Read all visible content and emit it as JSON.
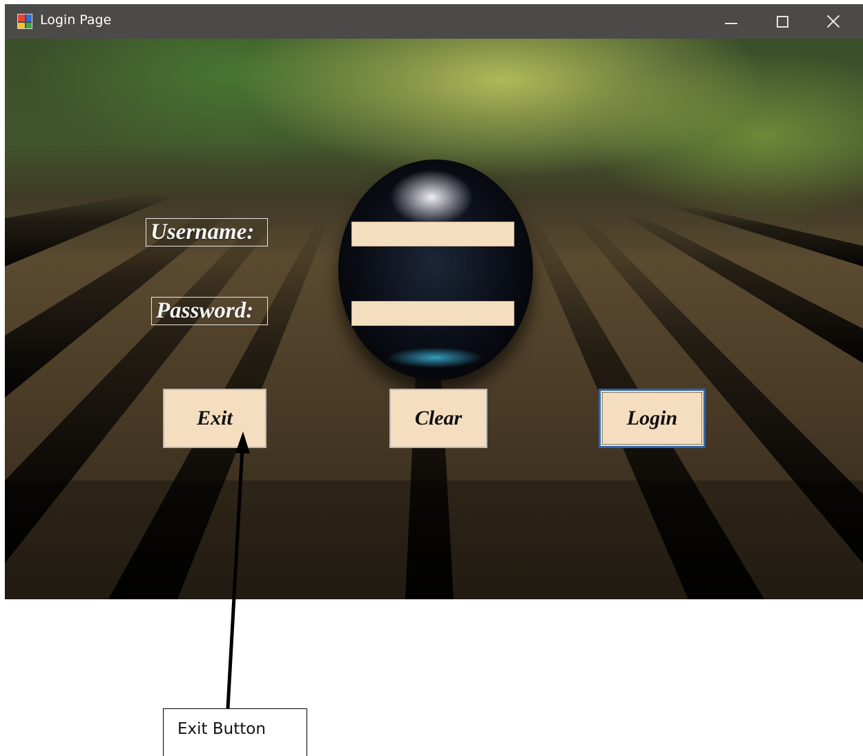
{
  "window": {
    "title": "Login Page",
    "icon": "winforms-app-icon",
    "controls": [
      "minimize-icon",
      "maximize-icon",
      "close-icon"
    ]
  },
  "form": {
    "username_label": "Username:",
    "password_label": "Password:",
    "username_value": "",
    "password_value": "",
    "buttons": {
      "exit": "Exit",
      "clear": "Clear",
      "login": "Login"
    }
  },
  "callout": {
    "label": "Exit Button"
  },
  "colors": {
    "titlebar": "#4c4a48",
    "input_bg": "#f5dec0",
    "button_bg": "#f5dec0",
    "focus_border": "#2b66b0"
  }
}
